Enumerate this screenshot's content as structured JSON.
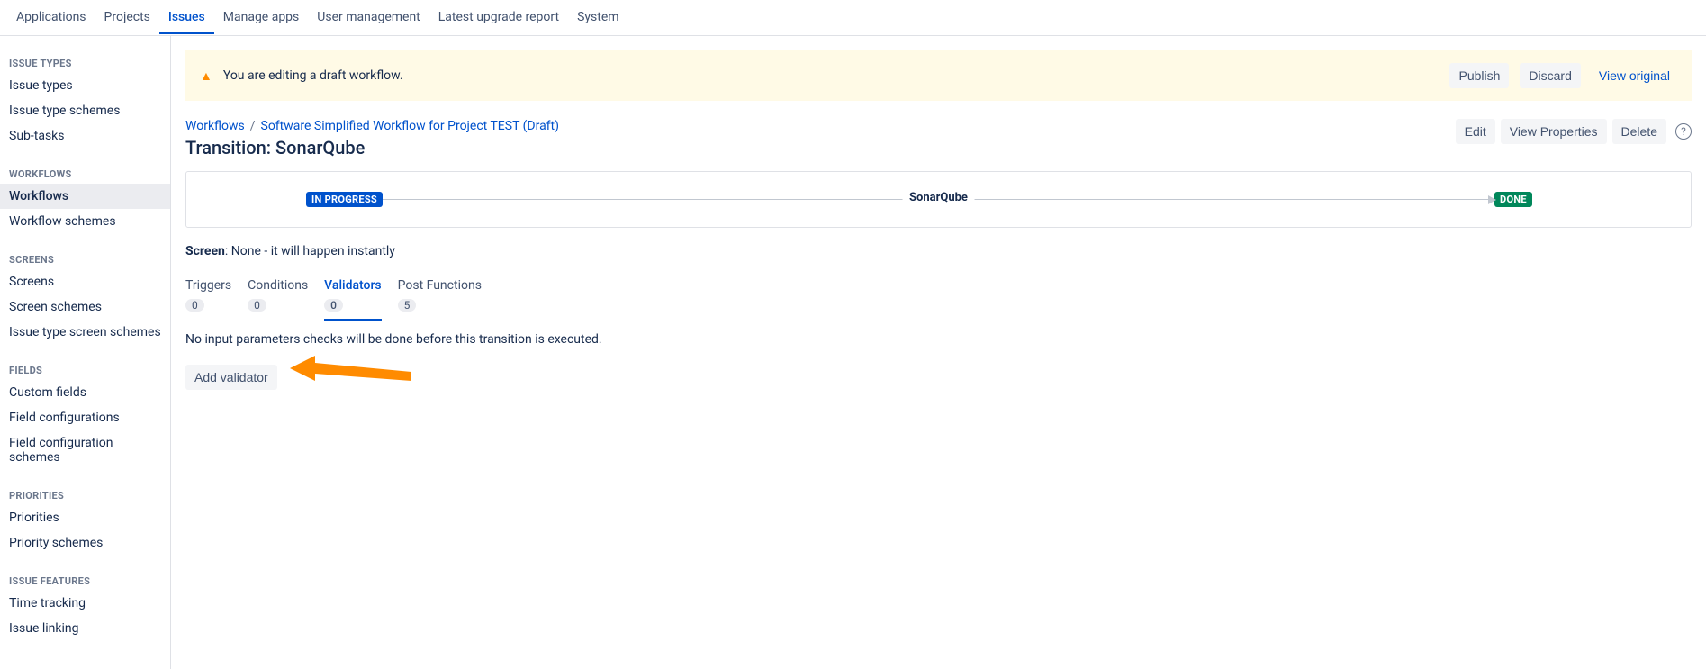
{
  "topnav": {
    "items": [
      {
        "label": "Applications"
      },
      {
        "label": "Projects"
      },
      {
        "label": "Issues",
        "active": true
      },
      {
        "label": "Manage apps"
      },
      {
        "label": "User management"
      },
      {
        "label": "Latest upgrade report"
      },
      {
        "label": "System"
      }
    ]
  },
  "sidebar": {
    "groups": [
      {
        "heading": "ISSUE TYPES",
        "items": [
          {
            "label": "Issue types"
          },
          {
            "label": "Issue type schemes"
          },
          {
            "label": "Sub-tasks"
          }
        ]
      },
      {
        "heading": "WORKFLOWS",
        "items": [
          {
            "label": "Workflows",
            "active": true
          },
          {
            "label": "Workflow schemes"
          }
        ]
      },
      {
        "heading": "SCREENS",
        "items": [
          {
            "label": "Screens"
          },
          {
            "label": "Screen schemes"
          },
          {
            "label": "Issue type screen schemes"
          }
        ]
      },
      {
        "heading": "FIELDS",
        "items": [
          {
            "label": "Custom fields"
          },
          {
            "label": "Field configurations"
          },
          {
            "label": "Field configuration schemes"
          }
        ]
      },
      {
        "heading": "PRIORITIES",
        "items": [
          {
            "label": "Priorities"
          },
          {
            "label": "Priority schemes"
          }
        ]
      },
      {
        "heading": "ISSUE FEATURES",
        "items": [
          {
            "label": "Time tracking"
          },
          {
            "label": "Issue linking"
          }
        ]
      }
    ]
  },
  "banner": {
    "text": "You are editing a draft workflow.",
    "publish": "Publish",
    "discard": "Discard",
    "view_original": "View original"
  },
  "breadcrumb": {
    "root": "Workflows",
    "current": "Software Simplified Workflow for Project TEST (Draft)"
  },
  "page": {
    "title": "Transition: SonarQube",
    "edit": "Edit",
    "view_properties": "View Properties",
    "delete": "Delete"
  },
  "transition": {
    "from": "IN PROGRESS",
    "name": "SonarQube",
    "to": "DONE"
  },
  "screen_line": {
    "label": "Screen",
    "value": ": None - it will happen instantly"
  },
  "tabs": [
    {
      "label": "Triggers",
      "count": "0"
    },
    {
      "label": "Conditions",
      "count": "0"
    },
    {
      "label": "Validators",
      "count": "0",
      "active": true
    },
    {
      "label": "Post Functions",
      "count": "5"
    }
  ],
  "validators": {
    "empty_text": "No input parameters checks will be done before this transition is executed.",
    "add_button": "Add validator"
  }
}
